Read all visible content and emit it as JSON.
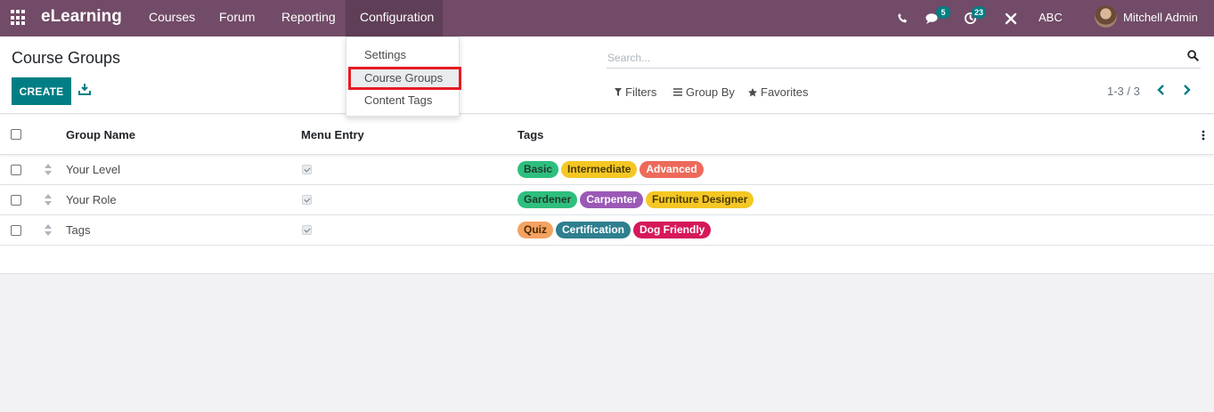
{
  "navbar": {
    "brand": "eLearning",
    "menu": [
      "Courses",
      "Forum",
      "Reporting",
      "Configuration"
    ],
    "messages_badge": "5",
    "activities_badge": "23",
    "company": "ABC",
    "user": "Mitchell Admin"
  },
  "dropdown": {
    "items": [
      "Settings",
      "Course Groups",
      "Content Tags"
    ],
    "highlighted": "Course Groups"
  },
  "control": {
    "title": "Course Groups",
    "create_label": "CREATE",
    "search_placeholder": "Search...",
    "filters_label": "Filters",
    "groupby_label": "Group By",
    "favorites_label": "Favorites",
    "pager": "1-3 / 3"
  },
  "table": {
    "headers": [
      "Group Name",
      "Menu Entry",
      "Tags"
    ],
    "rows": [
      {
        "name": "Your Level",
        "menu_entry": true,
        "tags": [
          {
            "label": "Basic",
            "bg": "#2ebf7e",
            "fg": "#1f3b2c"
          },
          {
            "label": "Intermediate",
            "bg": "#f4c724",
            "fg": "#4a3a00"
          },
          {
            "label": "Advanced",
            "bg": "#ed6a5a",
            "fg": "#ffffff"
          }
        ]
      },
      {
        "name": "Your Role",
        "menu_entry": true,
        "tags": [
          {
            "label": "Gardener",
            "bg": "#2ebf7e",
            "fg": "#1f3b2c"
          },
          {
            "label": "Carpenter",
            "bg": "#9b59b6",
            "fg": "#ffffff"
          },
          {
            "label": "Furniture Designer",
            "bg": "#f4c724",
            "fg": "#4a3a00"
          }
        ]
      },
      {
        "name": "Tags",
        "menu_entry": true,
        "tags": [
          {
            "label": "Quiz",
            "bg": "#f4a261",
            "fg": "#4a2a00"
          },
          {
            "label": "Certification",
            "bg": "#2f7f8f",
            "fg": "#ffffff"
          },
          {
            "label": "Dog Friendly",
            "bg": "#d6185a",
            "fg": "#ffffff"
          }
        ]
      }
    ]
  },
  "colors": {
    "navbar": "#714b67",
    "primary_button": "#017e84",
    "highlight_border": "#e51b24"
  }
}
